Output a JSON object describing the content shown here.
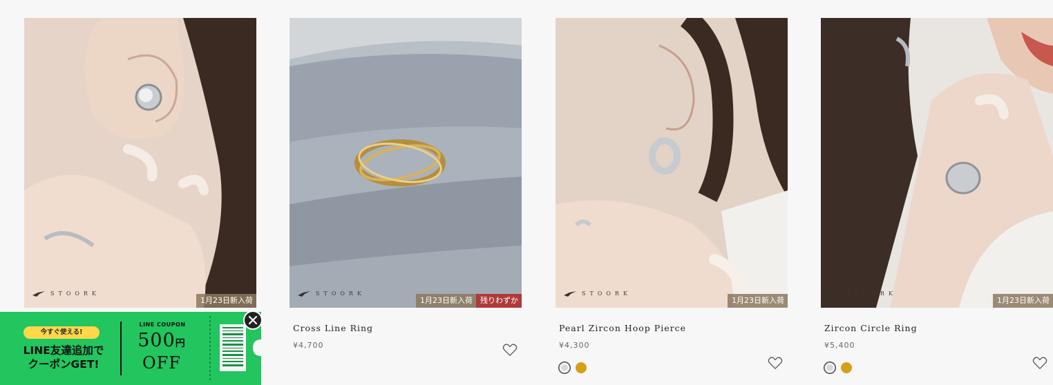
{
  "products": [
    {
      "name": "",
      "price": "",
      "badges": [
        "1月23日新入荷"
      ],
      "brand": "STOORK",
      "swatches": []
    },
    {
      "name": "Cross Line Ring",
      "price": "¥4,700",
      "badges": [
        "1月23日新入荷",
        "残りわずか"
      ],
      "brand": "STOORK",
      "swatches": []
    },
    {
      "name": "Pearl Zircon Hoop Pierce",
      "price": "¥4,300",
      "badges": [
        "1月23日新入荷"
      ],
      "brand": "STOORK",
      "swatches": [
        "silver",
        "gold"
      ]
    },
    {
      "name": "Zircon Circle Ring",
      "price": "¥5,400",
      "badges": [
        "1月23日新入荷"
      ],
      "brand": "STOORK",
      "swatches": [
        "silver",
        "gold"
      ]
    }
  ],
  "coupon": {
    "pill": "今すぐ使える!",
    "line1": "LINE友達追加で",
    "line2": "クーポンGET!",
    "label": "LINE COUPON",
    "amount": "500",
    "yen": "円",
    "off": "OFF"
  },
  "colors": {
    "background": "#f7f7f7",
    "badge_new": "#8c785f",
    "badge_few": "#b0393a",
    "coupon_green": "#22c55e",
    "gold_swatch": "#d4a017"
  }
}
